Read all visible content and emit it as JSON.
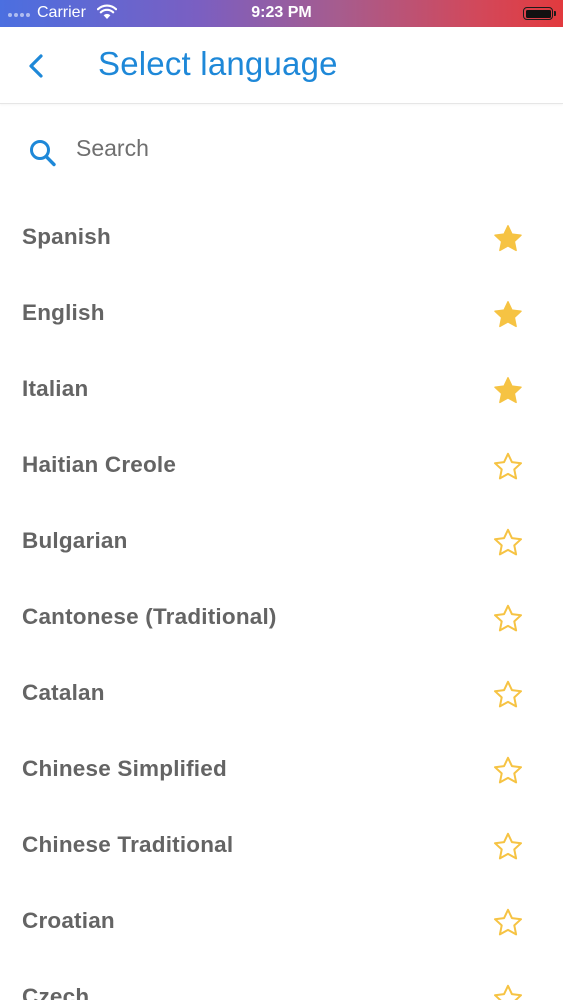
{
  "status_bar": {
    "carrier": "Carrier",
    "time": "9:23 PM"
  },
  "header": {
    "title": "Select language",
    "back_icon": "chevron-left-icon"
  },
  "search": {
    "placeholder": "Search",
    "value": "",
    "icon": "search-icon"
  },
  "colors": {
    "accent": "#1e88d8",
    "star": "#f6c343",
    "text": "#646464"
  },
  "languages": [
    {
      "name": "Spanish",
      "favorite": true
    },
    {
      "name": "English",
      "favorite": true
    },
    {
      "name": "Italian",
      "favorite": true
    },
    {
      "name": "Haitian Creole",
      "favorite": false
    },
    {
      "name": "Bulgarian",
      "favorite": false
    },
    {
      "name": "Cantonese (Traditional)",
      "favorite": false
    },
    {
      "name": "Catalan",
      "favorite": false
    },
    {
      "name": "Chinese Simplified",
      "favorite": false
    },
    {
      "name": "Chinese Traditional",
      "favorite": false
    },
    {
      "name": "Croatian",
      "favorite": false
    },
    {
      "name": "Czech",
      "favorite": false
    }
  ]
}
